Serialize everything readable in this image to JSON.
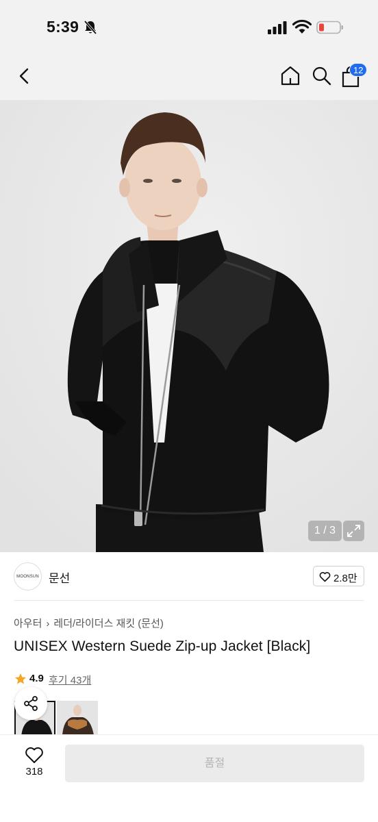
{
  "status_bar": {
    "time": "5:39",
    "battery_color": "#e8453c"
  },
  "nav": {
    "back_icon": "chevron-left-icon",
    "home_icon": "home-icon",
    "search_icon": "search-icon",
    "cart_icon": "shopping-bag-icon",
    "cart_count": "12",
    "badge_color": "#1f6cf0"
  },
  "gallery": {
    "counter": "1 / 3",
    "expand_icon": "expand-icon"
  },
  "brand": {
    "logo_text": "MOONSUN",
    "name": "문선",
    "likes": "2.8만"
  },
  "breadcrumb": {
    "category": "아우터",
    "subcategory": "레더/라이더스 재킷 (문선)"
  },
  "product": {
    "title": "UNISEX Western Suede Zip-up Jacket [Black]",
    "rating": "4.9",
    "reviews": "후기 43개",
    "star_color": "#f5a623"
  },
  "bottom_bar": {
    "wish_count": "318",
    "button_label": "품절"
  }
}
